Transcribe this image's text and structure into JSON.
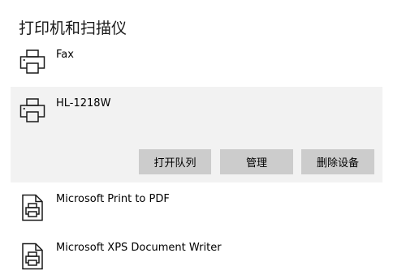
{
  "section": {
    "title": "打印机和扫描仪"
  },
  "printers": [
    {
      "name": "Fax",
      "icon": "printer-icon"
    },
    {
      "name": "HL-1218W",
      "icon": "printer-icon"
    },
    {
      "name": "Microsoft Print to PDF",
      "icon": "document-printer-icon"
    },
    {
      "name": "Microsoft XPS Document Writer",
      "icon": "document-printer-icon"
    }
  ],
  "actions": {
    "open_queue": "打开队列",
    "manage": "管理",
    "remove_device": "删除设备"
  },
  "colors": {
    "selected_background": "#f2f2f2",
    "button_background": "#cccccc"
  }
}
